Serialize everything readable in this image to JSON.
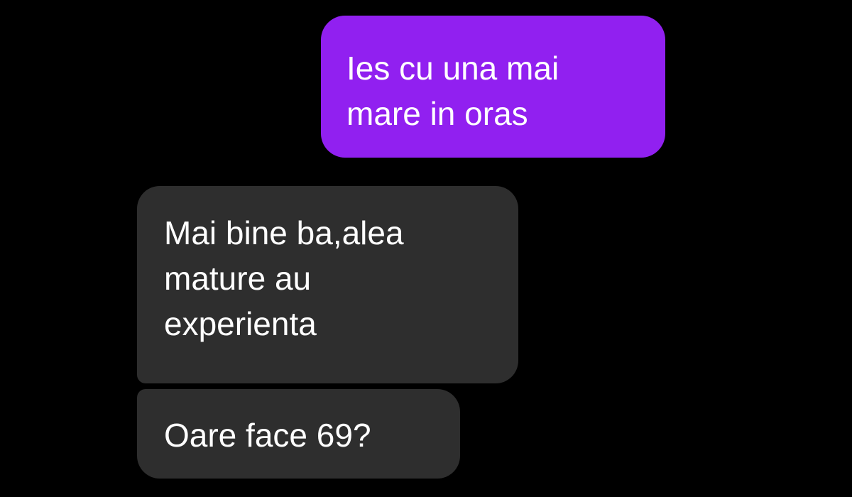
{
  "colors": {
    "background": "#000000",
    "outgoing_bubble": "#9120f0",
    "incoming_bubble": "#2e2e2e",
    "text": "#ffffff"
  },
  "messages": [
    {
      "direction": "outgoing",
      "text": "Ies cu una mai\nmare in oras"
    },
    {
      "direction": "incoming",
      "text": "Mai bine ba,alea\nmature au\nexperienta"
    },
    {
      "direction": "incoming",
      "text": "Oare face 69?"
    }
  ]
}
